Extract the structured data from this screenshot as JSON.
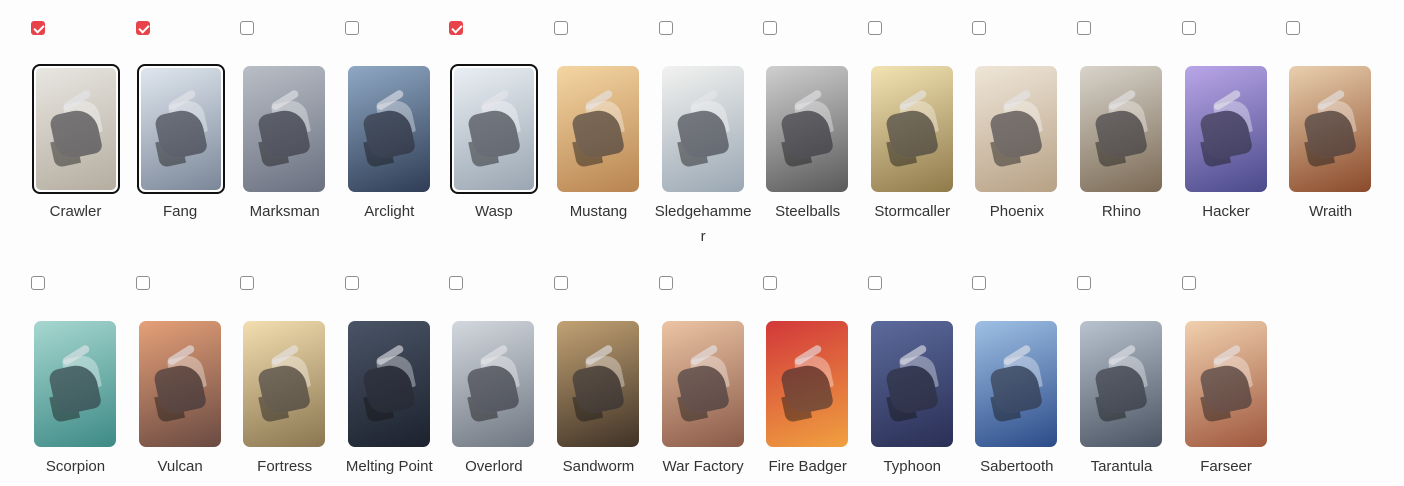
{
  "units": [
    {
      "name": "Crawler",
      "checked": true,
      "colors": [
        "#e8e6e1",
        "#b5ada0"
      ]
    },
    {
      "name": "Fang",
      "checked": true,
      "colors": [
        "#dfe6ee",
        "#7b8799"
      ]
    },
    {
      "name": "Marksman",
      "checked": false,
      "colors": [
        "#b9bec6",
        "#6a7080"
      ]
    },
    {
      "name": "Arclight",
      "checked": false,
      "colors": [
        "#8fa8c4",
        "#2f3d55"
      ]
    },
    {
      "name": "Wasp",
      "checked": true,
      "colors": [
        "#e9eef3",
        "#9aa6b2"
      ]
    },
    {
      "name": "Mustang",
      "checked": false,
      "colors": [
        "#f4d6a3",
        "#b88450"
      ]
    },
    {
      "name": "Sledgehammer",
      "checked": false,
      "colors": [
        "#f2f2f0",
        "#9aa7b3"
      ]
    },
    {
      "name": "Steelballs",
      "checked": false,
      "colors": [
        "#cfcfcf",
        "#5a5a5a"
      ]
    },
    {
      "name": "Stormcaller",
      "checked": false,
      "colors": [
        "#f3e3b3",
        "#8f7a4a"
      ]
    },
    {
      "name": "Phoenix",
      "checked": false,
      "colors": [
        "#efe6d8",
        "#b7a186"
      ]
    },
    {
      "name": "Rhino",
      "checked": false,
      "colors": [
        "#d8d4cb",
        "#7b6a55"
      ]
    },
    {
      "name": "Hacker",
      "checked": false,
      "colors": [
        "#b9a6e8",
        "#4a4a8a"
      ]
    },
    {
      "name": "Wraith",
      "checked": false,
      "colors": [
        "#e9cfae",
        "#8a4a2a"
      ]
    },
    {
      "name": "Scorpion",
      "checked": false,
      "colors": [
        "#a6d7d0",
        "#3e8a86"
      ]
    },
    {
      "name": "Vulcan",
      "checked": false,
      "colors": [
        "#e5a078",
        "#6a4a42"
      ]
    },
    {
      "name": "Fortress",
      "checked": false,
      "colors": [
        "#f3deb0",
        "#8a7650"
      ]
    },
    {
      "name": "Melting Point",
      "checked": false,
      "colors": [
        "#4a5466",
        "#1c222e"
      ]
    },
    {
      "name": "Overlord",
      "checked": false,
      "colors": [
        "#d3d8de",
        "#6f7782"
      ]
    },
    {
      "name": "Sandworm",
      "checked": false,
      "colors": [
        "#c2a274",
        "#3f3226"
      ]
    },
    {
      "name": "War Factory",
      "checked": false,
      "colors": [
        "#ecc4a4",
        "#8a5a48"
      ]
    },
    {
      "name": "Fire Badger",
      "checked": false,
      "colors": [
        "#d2383a",
        "#f0a040"
      ]
    },
    {
      "name": "Typhoon",
      "checked": false,
      "colors": [
        "#5c6a9c",
        "#2a2f55"
      ]
    },
    {
      "name": "Sabertooth",
      "checked": false,
      "colors": [
        "#9fc0e4",
        "#2c4c8a"
      ]
    },
    {
      "name": "Tarantula",
      "checked": false,
      "colors": [
        "#b9c3cf",
        "#4a5462"
      ]
    },
    {
      "name": "Farseer",
      "checked": false,
      "colors": [
        "#f0d0ae",
        "#a0583e"
      ]
    }
  ]
}
